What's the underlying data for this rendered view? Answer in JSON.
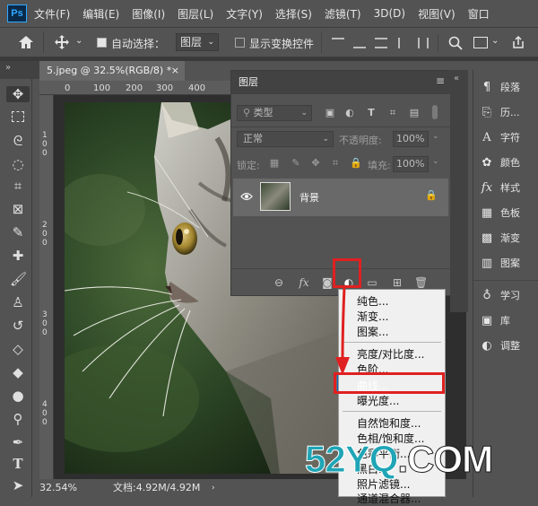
{
  "app": {
    "logo": "Ps"
  },
  "menu": [
    "文件(F)",
    "编辑(E)",
    "图像(I)",
    "图层(L)",
    "文字(Y)",
    "选择(S)",
    "滤镜(T)",
    "3D(D)",
    "视图(V)",
    "窗口"
  ],
  "options": {
    "auto_select_label": "自动选择：",
    "auto_select_value": "图层",
    "show_transform_label": "显示变换控件"
  },
  "document": {
    "tab_title": "5.jpeg @ 32.5%(RGB/8) *",
    "zoom": "32.54%",
    "doc_info": "文档:4.92M/4.92M"
  },
  "ruler_labels": [
    "0",
    "100",
    "200",
    "300",
    "400"
  ],
  "ruler_left_labels": [
    "1",
    "0",
    "0",
    "2",
    "0",
    "0",
    "3",
    "0",
    "0",
    "4",
    "0",
    "0"
  ],
  "layers_panel": {
    "title": "图层",
    "filter_label": "类型",
    "blend_mode": "正常",
    "opacity_label": "不透明度:",
    "opacity_value": "100%",
    "lock_label": "锁定:",
    "fill_label": "填充:",
    "fill_value": "100%",
    "layer_name": "背景"
  },
  "adjustment_menu": {
    "items_group1": [
      "纯色...",
      "渐变...",
      "图案..."
    ],
    "items_group2": [
      "亮度/对比度...",
      "色阶...",
      "曲线...",
      "曝光度..."
    ],
    "items_group3": [
      "自然饱和度...",
      "色相/饱和度...",
      "色彩平衡...",
      "黑白...",
      "照片滤镜...",
      "通道混合器..."
    ],
    "highlighted": "曲线..."
  },
  "right_panel": {
    "items": [
      {
        "icon": "paragraph-icon",
        "label": "段落"
      },
      {
        "icon": "history-icon",
        "label": "历..."
      },
      {
        "icon": "character-icon",
        "label": "字符"
      },
      {
        "icon": "color-icon",
        "label": "颜色"
      },
      {
        "icon": "styles-icon",
        "label": "样式"
      },
      {
        "icon": "swatches-icon",
        "label": "色板"
      },
      {
        "icon": "gradient-icon",
        "label": "渐变"
      },
      {
        "icon": "patterns-icon",
        "label": "图案"
      },
      {
        "icon": "learn-icon",
        "label": "学习"
      },
      {
        "icon": "library-icon",
        "label": "库"
      },
      {
        "icon": "adjustments-icon",
        "label": "调整"
      }
    ]
  },
  "watermark": {
    "part1": "52YQ",
    "part2": ".COM"
  },
  "colors": {
    "accent_blue": "#0a64c8",
    "highlight_red": "#e02020",
    "watermark_teal": "#1fa5b6",
    "panel_bg": "#535353"
  }
}
